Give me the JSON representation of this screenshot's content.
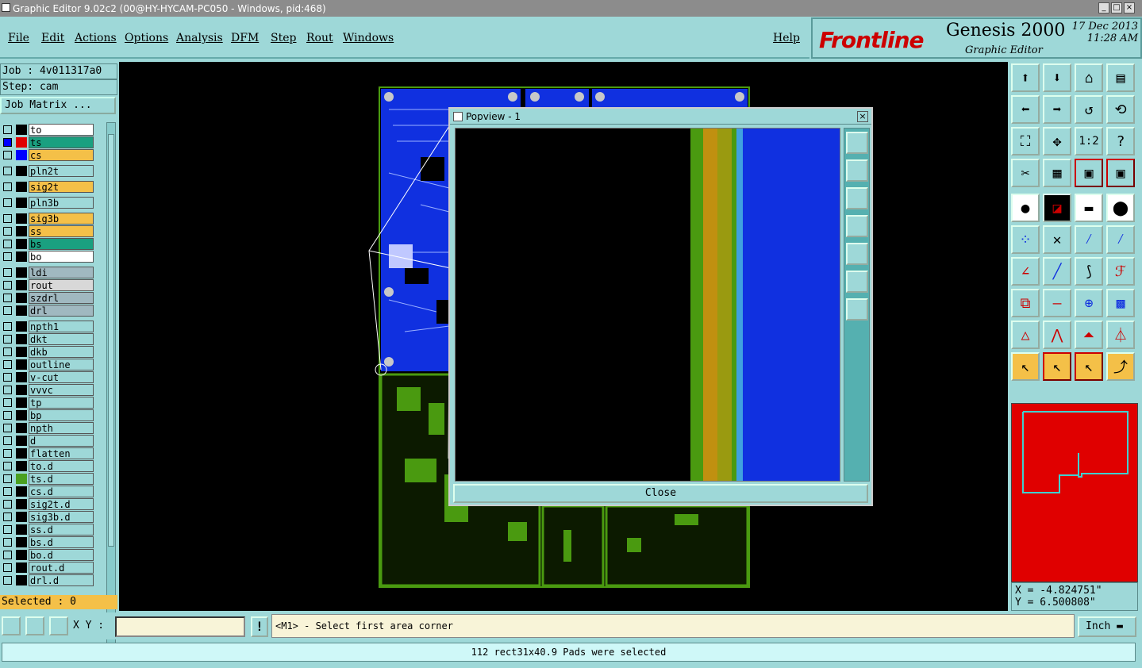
{
  "window": {
    "title": "Graphic Editor 9.02c2 (00@HY-HYCAM-PC050 - Windows, pid:468)"
  },
  "menu": [
    "File",
    "Edit",
    "Actions",
    "Options",
    "Analysis",
    "DFM",
    "Step",
    "Rout",
    "Windows"
  ],
  "help": "Help",
  "brand": {
    "logo": "Frontline",
    "product": "Genesis 2000",
    "subtitle": "Graphic Editor",
    "date": "17 Dec 2013",
    "time": "11:28 AM"
  },
  "job": {
    "job": "Job : 4v011317a0",
    "step": "Step: cam",
    "matrix": "Job Matrix ..."
  },
  "layers": [
    {
      "name": "to",
      "bg": "#ffffff",
      "sq": ""
    },
    {
      "name": "ts",
      "bg": "#1aa080",
      "sq": "#e00000",
      "mark": "#0000ff"
    },
    {
      "name": "cs",
      "bg": "#f4c048",
      "sq": "#0000ff"
    },
    {
      "name": "pln2t",
      "bg": "#9ed8d8",
      "sq": ""
    },
    {
      "name": "sig2t",
      "bg": "#f4c048",
      "sq": ""
    },
    {
      "name": "pln3b",
      "bg": "#9ed8d8",
      "sq": ""
    },
    {
      "name": "sig3b",
      "bg": "#f4c048",
      "sq": ""
    },
    {
      "name": "ss",
      "bg": "#f4c048",
      "sq": ""
    },
    {
      "name": "bs",
      "bg": "#1aa080",
      "sq": ""
    },
    {
      "name": "bo",
      "bg": "#ffffff",
      "sq": ""
    },
    {
      "name": "ldi",
      "bg": "#a0b8c0",
      "sq": ""
    },
    {
      "name": "rout",
      "bg": "#d8d8d8",
      "sq": ""
    },
    {
      "name": "szdrl",
      "bg": "#a0b8c0",
      "sq": ""
    },
    {
      "name": "drl",
      "bg": "#a0b8c0",
      "sq": ""
    },
    {
      "name": "npth1",
      "bg": "#9ed8d8",
      "sq": ""
    },
    {
      "name": "dkt",
      "bg": "#9ed8d8",
      "sq": ""
    },
    {
      "name": "dkb",
      "bg": "#9ed8d8",
      "sq": ""
    },
    {
      "name": "outline",
      "bg": "#9ed8d8",
      "sq": ""
    },
    {
      "name": "v-cut",
      "bg": "#9ed8d8",
      "sq": ""
    },
    {
      "name": "vvvc",
      "bg": "#9ed8d8",
      "sq": ""
    },
    {
      "name": "tp",
      "bg": "#9ed8d8",
      "sq": ""
    },
    {
      "name": "bp",
      "bg": "#9ed8d8",
      "sq": ""
    },
    {
      "name": "npth",
      "bg": "#9ed8d8",
      "sq": ""
    },
    {
      "name": "d",
      "bg": "#9ed8d8",
      "sq": ""
    },
    {
      "name": "flatten",
      "bg": "#9ed8d8",
      "sq": ""
    },
    {
      "name": "to.d",
      "bg": "#9ed8d8",
      "sq": ""
    },
    {
      "name": "ts.d",
      "bg": "#9ed8d8",
      "sq": "#4aa020"
    },
    {
      "name": "cs.d",
      "bg": "#9ed8d8",
      "sq": ""
    },
    {
      "name": "sig2t.d",
      "bg": "#9ed8d8",
      "sq": ""
    },
    {
      "name": "sig3b.d",
      "bg": "#9ed8d8",
      "sq": ""
    },
    {
      "name": "ss.d",
      "bg": "#9ed8d8",
      "sq": ""
    },
    {
      "name": "bs.d",
      "bg": "#9ed8d8",
      "sq": ""
    },
    {
      "name": "bo.d",
      "bg": "#9ed8d8",
      "sq": ""
    },
    {
      "name": "rout.d",
      "bg": "#9ed8d8",
      "sq": ""
    },
    {
      "name": "drl.d",
      "bg": "#9ed8d8",
      "sq": ""
    }
  ],
  "selected": "Selected : 0",
  "popview": {
    "title": "Popview - 1",
    "close": "Close"
  },
  "coords": {
    "x": "X = -4.824751\"",
    "y": "Y =  6.500808\""
  },
  "xy_label": "X Y :",
  "xy_value": "",
  "prompt": "<M1> - Select first area corner",
  "unit": "Inch",
  "status": "112 rect31x40.9 Pads were selected",
  "colors": {
    "bg": "#9ed8d8",
    "board_blue": "#1030e0",
    "board_green": "#4a9a10",
    "minimap": "#e00000"
  }
}
